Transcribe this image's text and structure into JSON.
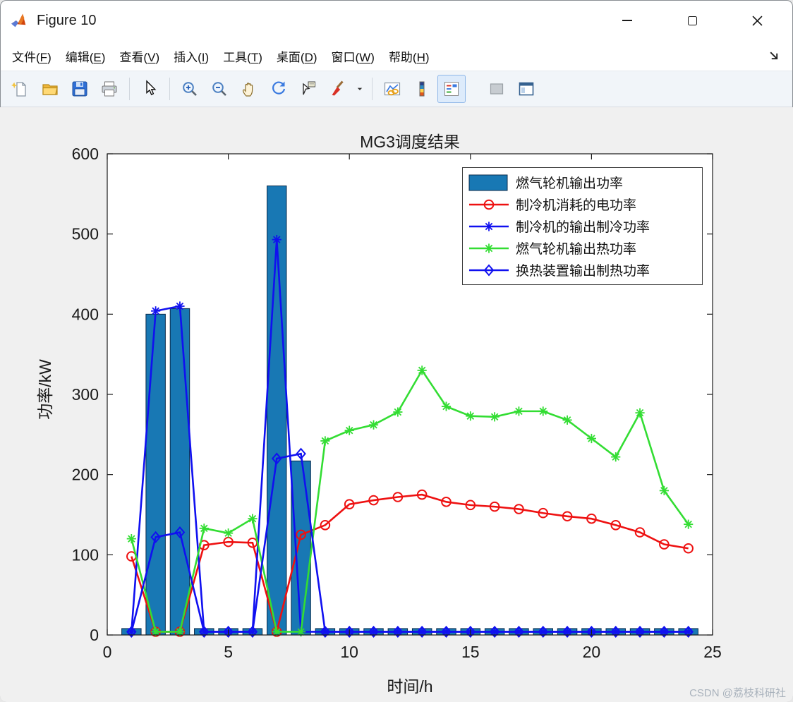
{
  "window": {
    "title": "Figure 10",
    "controls": [
      {
        "name": "minimize"
      },
      {
        "name": "maximize"
      },
      {
        "name": "close"
      }
    ]
  },
  "menu": {
    "items": [
      "文件(F)",
      "编辑(E)",
      "查看(V)",
      "插入(I)",
      "工具(T)",
      "桌面(D)",
      "窗口(W)",
      "帮助(H)"
    ]
  },
  "toolbar": {
    "buttons": [
      {
        "name": "new-figure",
        "icon": "new-document-icon"
      },
      {
        "name": "open-file",
        "icon": "open-folder-icon"
      },
      {
        "name": "save-figure",
        "icon": "save-icon"
      },
      {
        "name": "print-figure",
        "icon": "print-icon"
      },
      {
        "name": "edit-plot",
        "icon": "pointer-icon",
        "sep_before": true
      },
      {
        "name": "zoom-in",
        "icon": "zoom-in-icon",
        "sep_before": true
      },
      {
        "name": "zoom-out",
        "icon": "zoom-out-icon"
      },
      {
        "name": "pan",
        "icon": "hand-icon"
      },
      {
        "name": "rotate-3d",
        "icon": "rotate-icon"
      },
      {
        "name": "data-cursor",
        "icon": "data-cursor-icon"
      },
      {
        "name": "brush-data",
        "icon": "brush-icon"
      },
      {
        "name": "brush-menu",
        "icon": "dropdown-caret-icon"
      },
      {
        "name": "link-plot",
        "icon": "link-plot-icon",
        "sep_before": true
      },
      {
        "name": "insert-colorbar",
        "icon": "colorbar-icon"
      },
      {
        "name": "insert-legend",
        "icon": "legend-icon",
        "active": true
      },
      {
        "name": "hide-plot-tools",
        "icon": "plot-tools-off-icon",
        "gap_before": true
      },
      {
        "name": "show-plot-tools",
        "icon": "plot-tools-dock-icon"
      }
    ]
  },
  "chart_data": {
    "type": "combo",
    "title": "MG3调度结果",
    "xlabel": "时间/h",
    "ylabel": "功率/kW",
    "xlim": [
      0,
      25
    ],
    "ylim": [
      0,
      600
    ],
    "xticks": [
      0,
      5,
      10,
      15,
      20,
      25
    ],
    "yticks": [
      0,
      100,
      200,
      300,
      400,
      500,
      600
    ],
    "grid": false,
    "legend_position": "top-right",
    "axis_color": "#1a1a1a",
    "x": [
      1,
      2,
      3,
      4,
      5,
      6,
      7,
      8,
      9,
      10,
      11,
      12,
      13,
      14,
      15,
      16,
      17,
      18,
      19,
      20,
      21,
      22,
      23,
      24
    ],
    "series": [
      {
        "name": "燃气轮机输出功率",
        "type": "bar",
        "color": "#1878b4",
        "edge_color": "#0a2a4a",
        "values": [
          8,
          400,
          407,
          8,
          8,
          8,
          560,
          217,
          8,
          8,
          8,
          8,
          8,
          8,
          8,
          8,
          8,
          8,
          8,
          8,
          8,
          8,
          8,
          8
        ]
      },
      {
        "name": "制冷机消耗的电功率",
        "type": "line",
        "marker": "circle",
        "color": "#ee1111",
        "values": [
          98,
          4,
          4,
          112,
          116,
          115,
          4,
          125,
          137,
          163,
          168,
          172,
          175,
          166,
          162,
          160,
          157,
          152,
          148,
          145,
          137,
          128,
          113,
          108
        ]
      },
      {
        "name": "制冷机的输出制冷功率",
        "type": "line",
        "marker": "asterisk",
        "color": "#1010f0",
        "values": [
          4,
          404,
          410,
          4,
          4,
          4,
          493,
          4,
          4,
          4,
          4,
          4,
          4,
          4,
          4,
          4,
          4,
          4,
          4,
          4,
          4,
          4,
          4,
          4
        ]
      },
      {
        "name": "燃气轮机输出热功率",
        "type": "line",
        "marker": "asterisk",
        "color": "#33dd33",
        "values": [
          120,
          4,
          4,
          133,
          127,
          145,
          4,
          4,
          242,
          255,
          262,
          278,
          330,
          285,
          273,
          272,
          279,
          279,
          268,
          245,
          222,
          277,
          180,
          138
        ]
      },
      {
        "name": "换热装置输出制热功率",
        "type": "line",
        "marker": "diamond",
        "color": "#1010f0",
        "values": [
          4,
          122,
          128,
          4,
          4,
          4,
          220,
          226,
          4,
          4,
          4,
          4,
          4,
          4,
          4,
          4,
          4,
          4,
          4,
          4,
          4,
          4,
          4,
          4
        ]
      }
    ]
  },
  "watermark": "CSDN @荔枝科研社"
}
